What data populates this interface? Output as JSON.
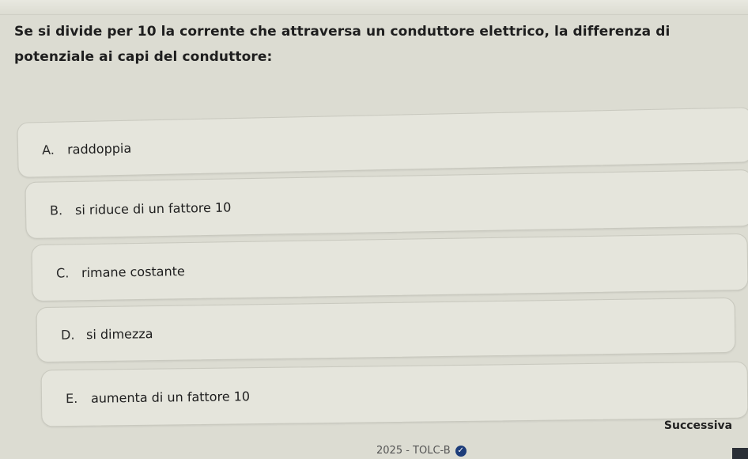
{
  "question": {
    "text": "Se si divide per 10 la corrente che attraversa un conduttore elettrico, la differenza di potenziale ai capi del conduttore:"
  },
  "options": [
    {
      "letter": "A.",
      "text": "raddoppia"
    },
    {
      "letter": "B.",
      "text": "si riduce di un fattore 10"
    },
    {
      "letter": "C.",
      "text": "rimane costante"
    },
    {
      "letter": "D.",
      "text": "si dimezza"
    },
    {
      "letter": "E.",
      "text": "aumenta di un fattore 10"
    }
  ],
  "navigation": {
    "next_label": "Successiva"
  },
  "footer": {
    "text": "2025 - TOLC-B",
    "icon": "check-badge-icon",
    "icon_color": "#1d3d7a"
  }
}
